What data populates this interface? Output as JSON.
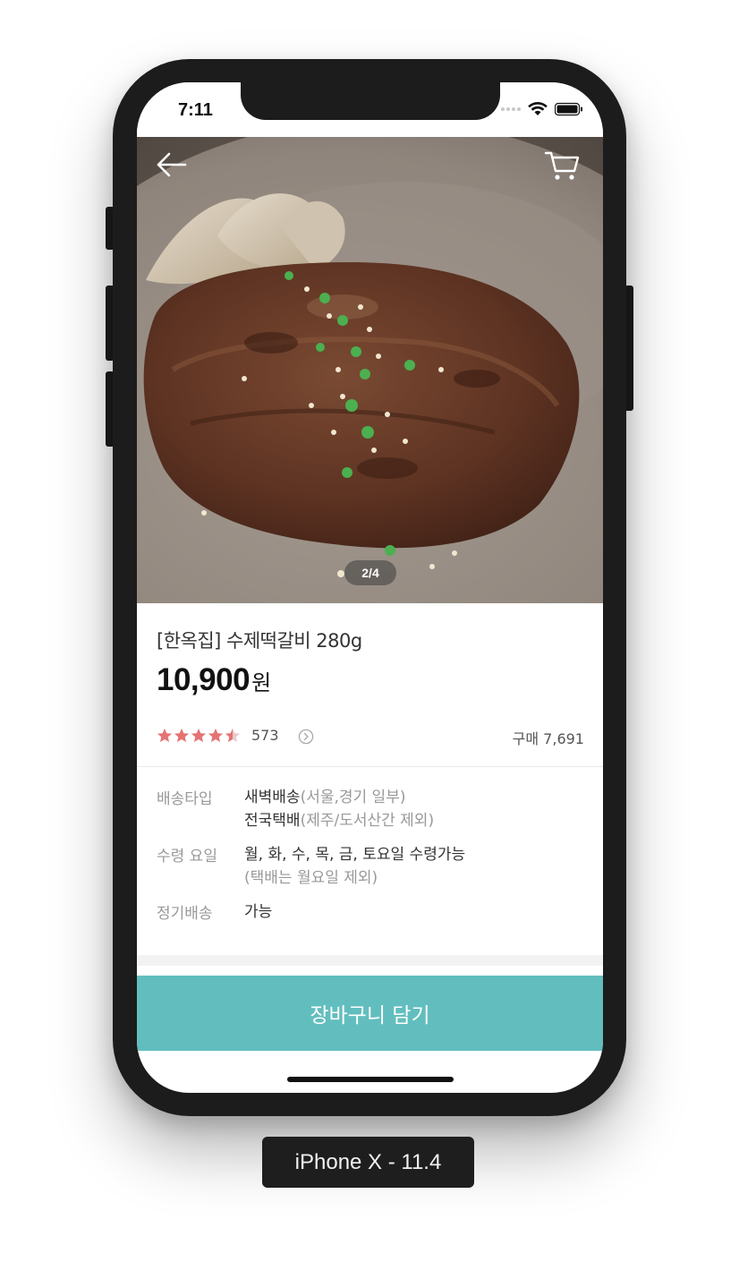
{
  "status_bar": {
    "time": "7:11",
    "icons": [
      "signal-dots-icon",
      "wifi-icon",
      "battery-icon"
    ]
  },
  "hero": {
    "page_indicator": "2/4",
    "icons": {
      "back": "arrow-left-icon",
      "cart": "cart-icon"
    }
  },
  "product": {
    "name": "[한옥집] 수제떡갈비 280g",
    "price": "10,900",
    "price_unit": "원",
    "rating": 4.5,
    "rating_max": 5,
    "review_count": "573",
    "purchase_count": "구매 7,691"
  },
  "details": [
    {
      "label": "배송타입",
      "lines": [
        {
          "main": "새벽배송",
          "sub": "(서울,경기 일부)"
        },
        {
          "main": "전국택배",
          "sub": "(제주/도서산간 제외)"
        }
      ]
    },
    {
      "label": "수령 요일",
      "lines": [
        {
          "main": "월, 화, 수, 목, 금, 토요일 수령가능",
          "sub": ""
        },
        {
          "main": "",
          "sub": "(택배는 월요일 제외)"
        }
      ]
    },
    {
      "label": "정기배송",
      "lines": [
        {
          "main": "가능",
          "sub": ""
        }
      ]
    }
  ],
  "actions": {
    "add_to_cart": "장바구니 담기"
  },
  "device_label": "iPhone X - 11.4",
  "colors": {
    "accent": "#62bebe",
    "star": "#e57373",
    "phone_frame": "#1c1c1c"
  }
}
